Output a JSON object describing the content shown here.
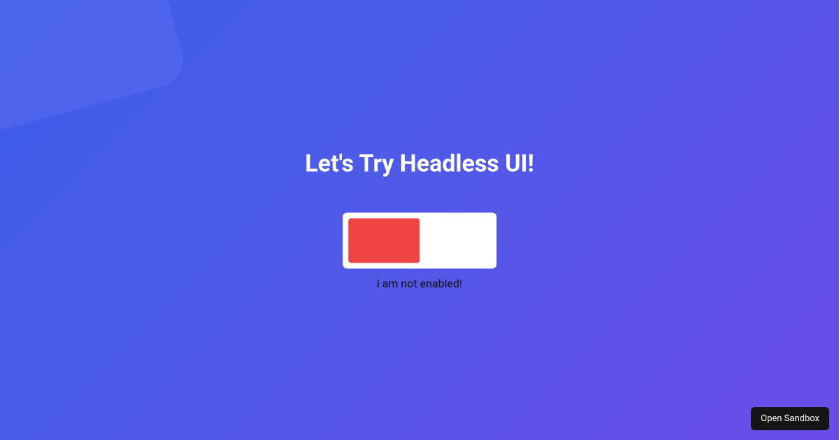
{
  "heading": "Let's Try Headless UI!",
  "toggle": {
    "enabled": false,
    "status_text": "i am not enabled!",
    "track_color": "#ffffff",
    "thumb_color_off": "#ef4444"
  },
  "sandbox_button": {
    "label": "Open Sandbox"
  }
}
